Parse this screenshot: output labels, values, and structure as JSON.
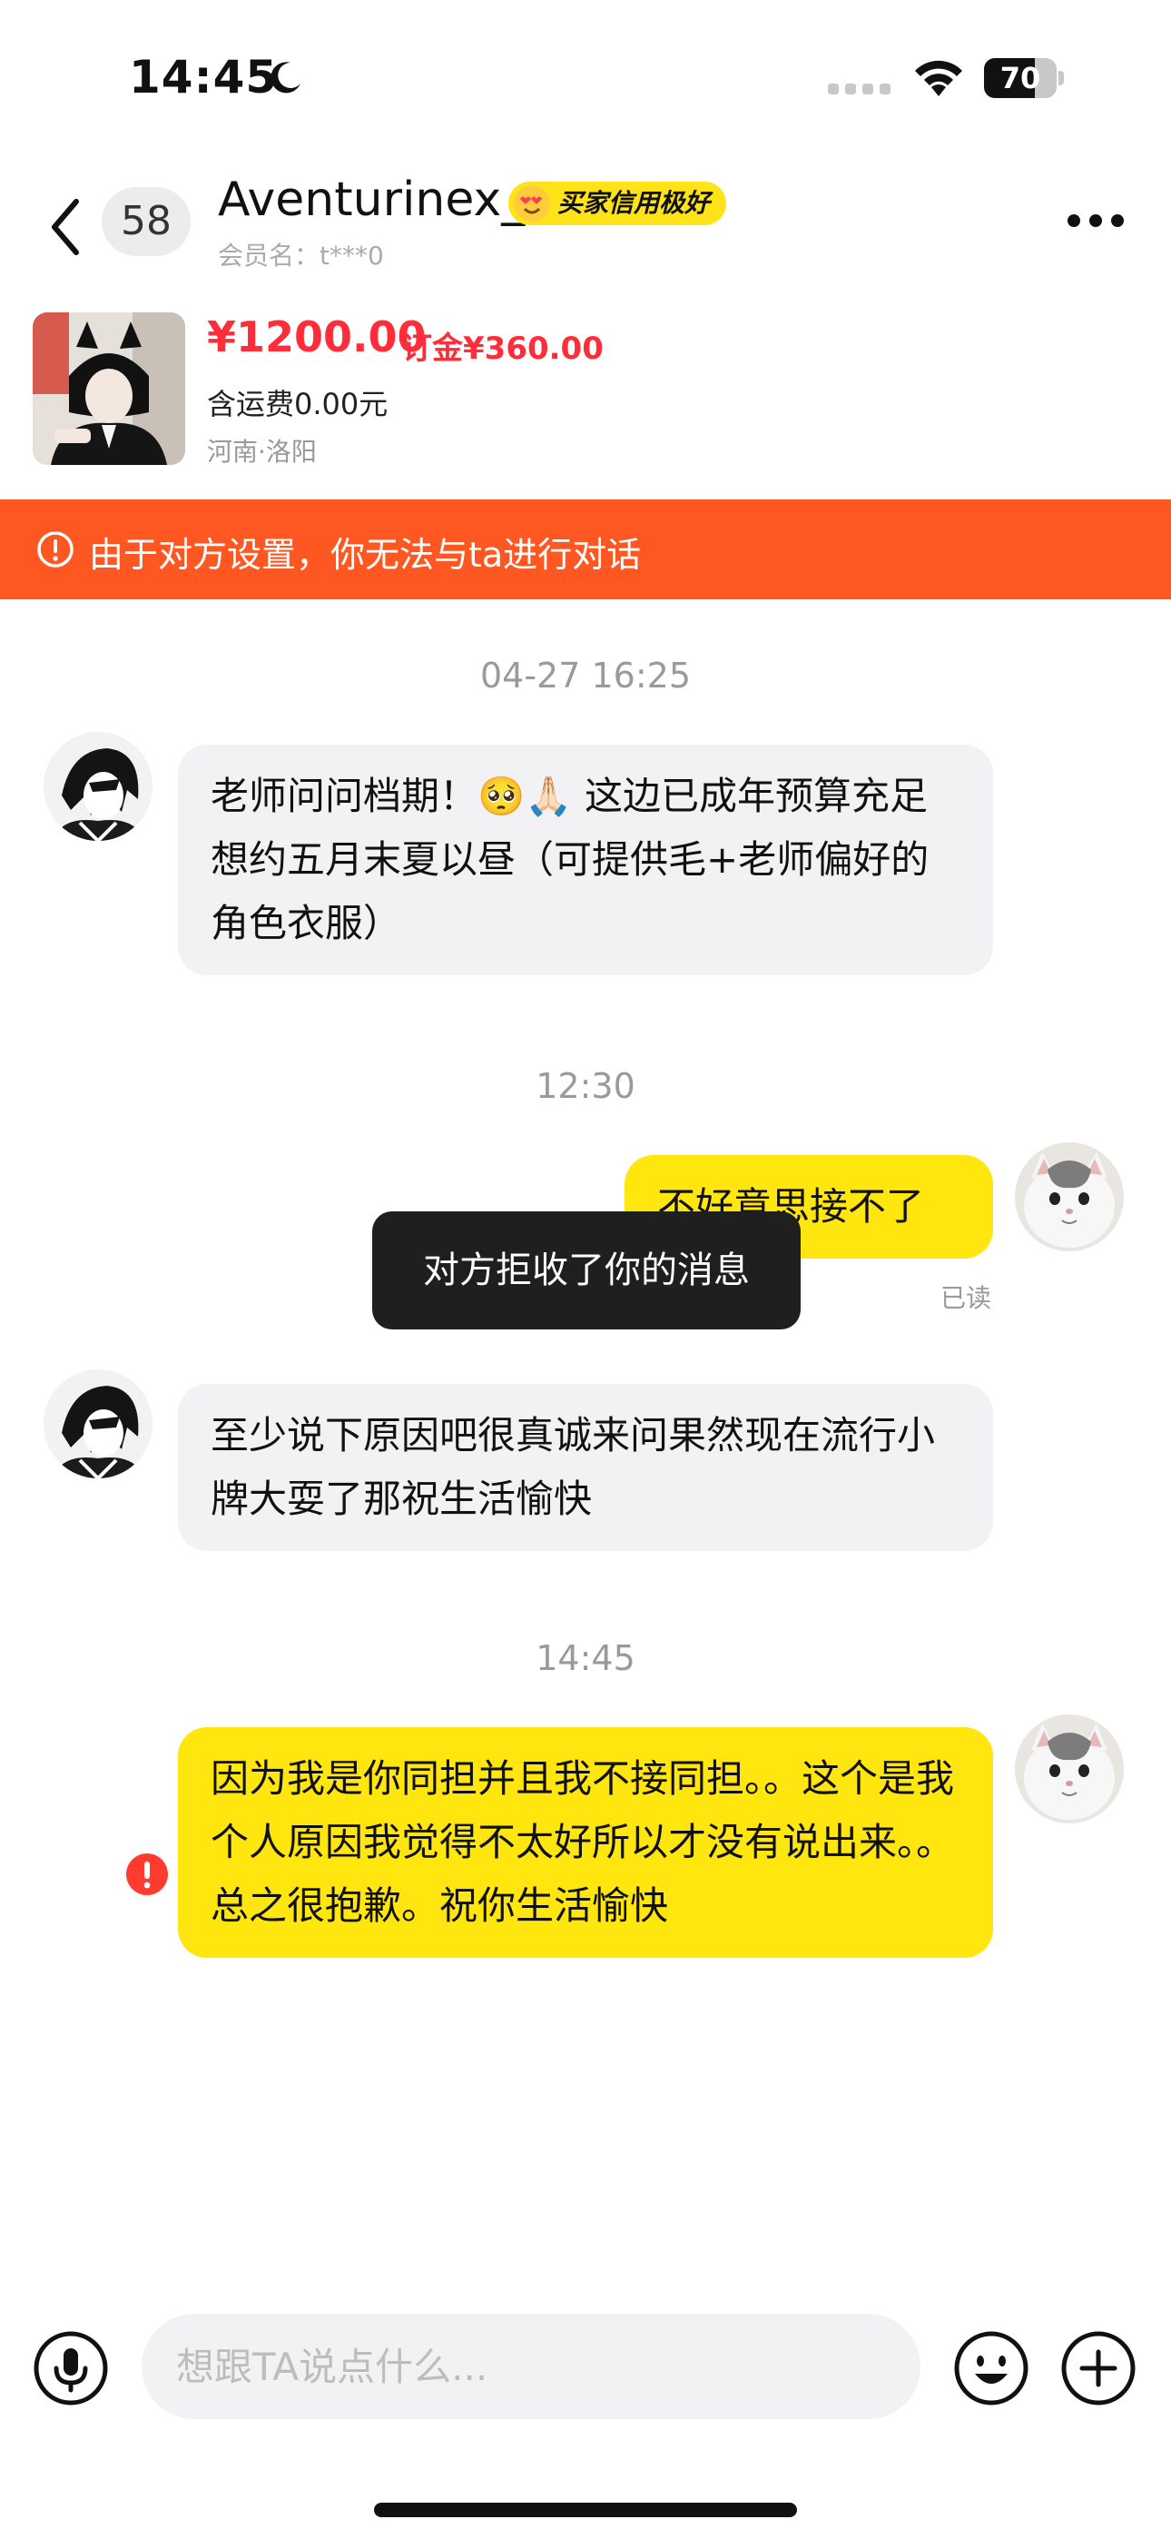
{
  "status_bar": {
    "time": "14:45",
    "battery_level": "70",
    "battery_fraction": 0.7
  },
  "header": {
    "unread_count": "58",
    "contact_name": "Aventurinex_",
    "credit_badge": "买家信用极好",
    "member_name": "会员名：t***0"
  },
  "product": {
    "price": "¥1200.00",
    "deposit": "订金¥360.00",
    "shipping": "含运费0.00元",
    "location": "河南·洛阳"
  },
  "warning": {
    "text": "由于对方设置，你无法与ta进行对话"
  },
  "chat": {
    "timestamps": [
      "04-27 16:25",
      "12:30",
      "14:45"
    ],
    "messages": [
      {
        "direction": "in",
        "text": "老师问问档期！🥺🙏🏻 这边已成年预算充足 想约五月末夏以昼（可提供毛+老师偏好的角色衣服）"
      },
      {
        "direction": "out",
        "text": "不好意思接不了"
      },
      {
        "direction": "in",
        "text": "至少说下原因吧很真诚来问果然现在流行小牌大耍了那祝生活愉快"
      },
      {
        "direction": "out",
        "text": "因为我是你同担并且我不接同担。。这个是我个人原因我觉得不太好所以才没有说出来。。总之很抱歉。祝你生活愉快"
      }
    ],
    "read_status": "已读",
    "toast": "对方拒收了你的消息"
  },
  "input_bar": {
    "placeholder": "想跟TA说点什么..."
  },
  "colors": {
    "accent_yellow": "#ffe60f",
    "warning_orange": "#ff5722",
    "price_red": "#ff2d3a",
    "error_red": "#ff3b30"
  },
  "icons": [
    "moon-icon",
    "signal-icon",
    "wifi-icon",
    "back-arrow-icon",
    "more-icon",
    "warning-icon",
    "error-icon",
    "microphone-icon",
    "emoji-icon",
    "plus-icon"
  ]
}
